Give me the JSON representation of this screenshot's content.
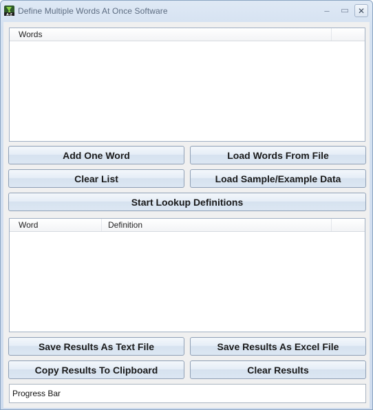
{
  "window": {
    "title": "Define Multiple Words At Once Software",
    "minimize_glyph": "–",
    "maximize_glyph": "▭",
    "close_glyph": "✕"
  },
  "words_list": {
    "columns": [
      "Words"
    ],
    "rows": []
  },
  "buttons": {
    "add_one_word": "Add One Word",
    "load_words_from_file": "Load Words From File",
    "clear_list": "Clear List",
    "load_sample_data": "Load Sample/Example Data",
    "start_lookup": "Start Lookup Definitions",
    "save_text_file": "Save Results As Text File",
    "save_excel_file": "Save Results As Excel File",
    "copy_clipboard": "Copy Results To Clipboard",
    "clear_results": "Clear Results"
  },
  "results_list": {
    "columns": [
      "Word",
      "Definition"
    ],
    "rows": []
  },
  "progress_bar": {
    "label": "Progress Bar"
  },
  "colors": {
    "window_frame": "#d4e1f1",
    "client_bg": "#f0f0f0",
    "button_border": "#8e9fb5"
  }
}
